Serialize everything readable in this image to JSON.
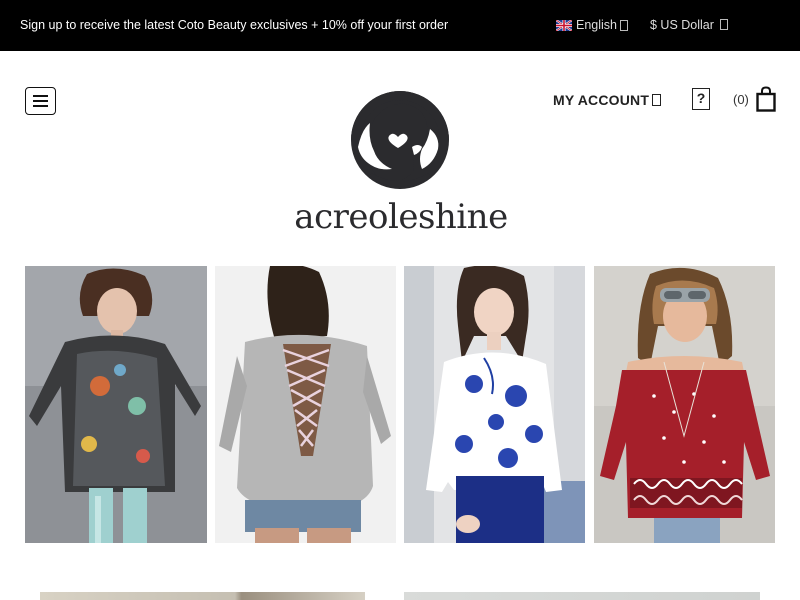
{
  "topbar": {
    "promo_text": "Sign up to receive the latest Coto Beauty exclusives + 10% off your first order",
    "language_label": "English",
    "currency_label": "$ US Dollar"
  },
  "header": {
    "account_label": "MY ACCOUNT",
    "cart_count": "(0)",
    "brand_name": "acreoleshine",
    "menu_icon": "hamburger-icon",
    "wishlist_icon": "wishlist-icon",
    "cart_icon": "shopping-bag-icon"
  },
  "products": [
    {
      "icon": "product-photo-sheer-floral-shirt",
      "colors": [
        "#9a9ba0",
        "#3b3b3b",
        "#a9d6d6"
      ]
    },
    {
      "icon": "product-photo-lace-up-back-sweater",
      "colors": [
        "#a8a8a8",
        "#c7c7c7",
        "#6f89a3"
      ]
    },
    {
      "icon": "product-photo-blue-floral-blouse",
      "colors": [
        "#ffffff",
        "#1f3fa3",
        "#1a2a6b"
      ]
    },
    {
      "icon": "product-photo-red-off-shoulder-top",
      "colors": [
        "#a3202a",
        "#cfcfcf",
        "#ffffff"
      ]
    }
  ],
  "colors": {
    "topbar_bg": "#000000",
    "text_dark": "#222222",
    "brand_ink": "#2b2b2e"
  }
}
